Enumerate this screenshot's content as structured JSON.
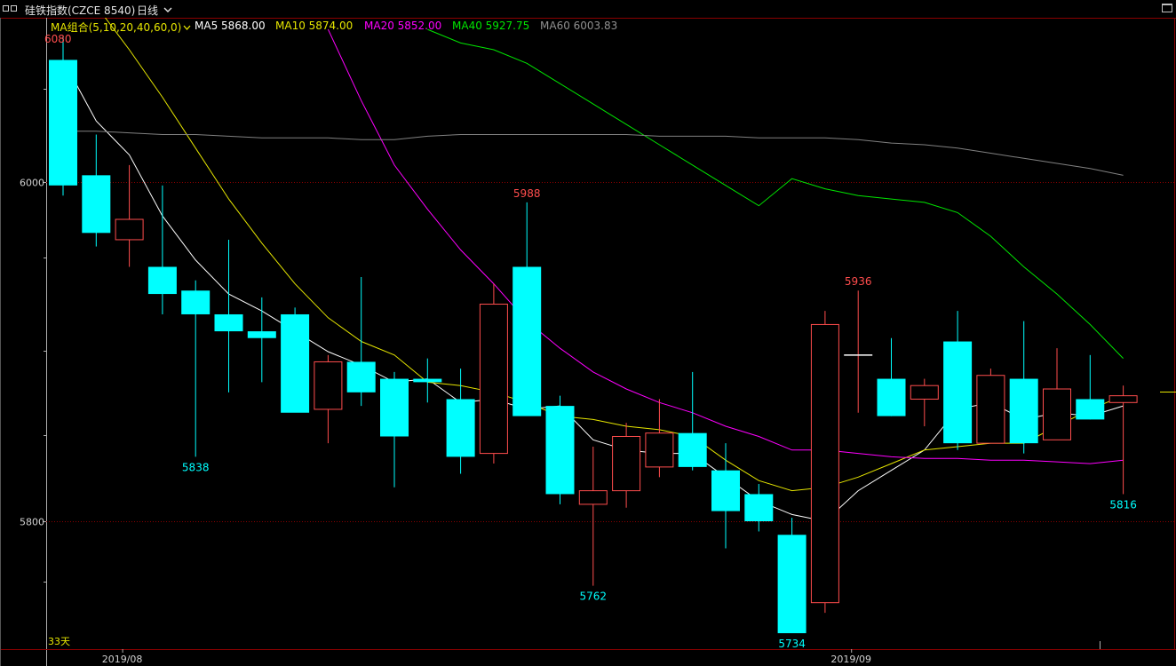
{
  "window": {
    "title": "硅铁指数(CZCE 8540)",
    "period": "日线"
  },
  "ma_bar": {
    "group_label": "MA组合(5,10,20,40,60,0)",
    "ma5": {
      "label": "MA5 5868.00",
      "color": "#ffffff"
    },
    "ma10": {
      "label": "MA10 5874.00",
      "color": "#e6e600"
    },
    "ma20": {
      "label": "MA20 5852.00",
      "color": "#ff00ff"
    },
    "ma40": {
      "label": "MA40 5927.75",
      "color": "#00e600"
    },
    "ma60": {
      "label": "MA60 6003.83",
      "color": "#808080"
    }
  },
  "colors": {
    "up": "#ff4d4d",
    "down": "#00ffff",
    "grid": "#8a0000",
    "axis_text": "#d0d0d0",
    "label_up": "#ff4d4d",
    "label_down": "#00ffff"
  },
  "icons": [
    "menu-icon",
    "chevron-down-icon",
    "maximize-icon"
  ],
  "footer": {
    "day_count": "33天"
  },
  "chart_data": {
    "type": "candlestick",
    "y_ticks": [
      6000,
      5800
    ],
    "y_range": [
      5668,
      6084
    ],
    "x_labels": [
      {
        "text": "2019/08",
        "index": 2
      },
      {
        "text": "2019/09",
        "index": 24
      }
    ],
    "top_label": "6080",
    "annotations": [
      {
        "text": "5988",
        "index": 14,
        "value": 5988,
        "kind": "high"
      },
      {
        "text": "5936",
        "index": 24,
        "value": 5936,
        "kind": "high"
      },
      {
        "text": "5838",
        "index": 4,
        "value": 5838,
        "kind": "low"
      },
      {
        "text": "5762",
        "index": 16,
        "value": 5762,
        "kind": "low"
      },
      {
        "text": "5734",
        "index": 22,
        "value": 5734,
        "kind": "low"
      },
      {
        "text": "5816",
        "index": 32,
        "value": 5816,
        "kind": "low"
      }
    ],
    "candles": [
      {
        "o": 6072,
        "h": 6086,
        "l": 5992,
        "c": 5998
      },
      {
        "o": 6004,
        "h": 6028,
        "l": 5962,
        "c": 5970
      },
      {
        "o": 5966,
        "h": 6010,
        "l": 5950,
        "c": 5978
      },
      {
        "o": 5950,
        "h": 5998,
        "l": 5922,
        "c": 5934
      },
      {
        "o": 5936,
        "h": 5942,
        "l": 5838,
        "c": 5922
      },
      {
        "o": 5922,
        "h": 5966,
        "l": 5876,
        "c": 5912
      },
      {
        "o": 5912,
        "h": 5932,
        "l": 5882,
        "c": 5908
      },
      {
        "o": 5922,
        "h": 5926,
        "l": 5866,
        "c": 5864
      },
      {
        "o": 5866,
        "h": 5898,
        "l": 5846,
        "c": 5894
      },
      {
        "o": 5894,
        "h": 5944,
        "l": 5868,
        "c": 5876
      },
      {
        "o": 5884,
        "h": 5888,
        "l": 5820,
        "c": 5850
      },
      {
        "o": 5884,
        "h": 5896,
        "l": 5870,
        "c": 5882
      },
      {
        "o": 5872,
        "h": 5890,
        "l": 5828,
        "c": 5838
      },
      {
        "o": 5840,
        "h": 5940,
        "l": 5834,
        "c": 5928
      },
      {
        "o": 5950,
        "h": 5988,
        "l": 5866,
        "c": 5862
      },
      {
        "o": 5868,
        "h": 5874,
        "l": 5810,
        "c": 5816
      },
      {
        "o": 5810,
        "h": 5844,
        "l": 5762,
        "c": 5818
      },
      {
        "o": 5818,
        "h": 5858,
        "l": 5808,
        "c": 5850
      },
      {
        "o": 5832,
        "h": 5872,
        "l": 5826,
        "c": 5852
      },
      {
        "o": 5852,
        "h": 5888,
        "l": 5830,
        "c": 5832
      },
      {
        "o": 5830,
        "h": 5846,
        "l": 5784,
        "c": 5806
      },
      {
        "o": 5816,
        "h": 5822,
        "l": 5794,
        "c": 5800
      },
      {
        "o": 5792,
        "h": 5802,
        "l": 5734,
        "c": 5734
      },
      {
        "o": 5752,
        "h": 5924,
        "l": 5746,
        "c": 5916
      },
      {
        "o": 5898,
        "h": 5936,
        "l": 5864,
        "c": 5898
      },
      {
        "o": 5884,
        "h": 5908,
        "l": 5862,
        "c": 5862
      },
      {
        "o": 5872,
        "h": 5884,
        "l": 5856,
        "c": 5880
      },
      {
        "o": 5906,
        "h": 5924,
        "l": 5842,
        "c": 5846
      },
      {
        "o": 5846,
        "h": 5890,
        "l": 5846,
        "c": 5886
      },
      {
        "o": 5884,
        "h": 5918,
        "l": 5840,
        "c": 5846
      },
      {
        "o": 5848,
        "h": 5902,
        "l": 5848,
        "c": 5878
      },
      {
        "o": 5872,
        "h": 5898,
        "l": 5860,
        "c": 5860
      },
      {
        "o": 5870,
        "h": 5880,
        "l": 5816,
        "c": 5874
      }
    ],
    "series": [
      {
        "name": "MA5",
        "color": "#ffffff",
        "values": [
          6072,
          6036,
          6016,
          5980,
          5954,
          5934,
          5924,
          5912,
          5900,
          5892,
          5882,
          5884,
          5870,
          5872,
          5866,
          5868,
          5848,
          5842,
          5840,
          5840,
          5826,
          5812,
          5804,
          5800,
          5818,
          5830,
          5842,
          5866,
          5870,
          5860,
          5864,
          5862,
          5868
        ]
      },
      {
        "name": "MA10",
        "color": "#e6e600",
        "values": [
          6130,
          6104,
          6078,
          6050,
          6020,
          5990,
          5964,
          5940,
          5920,
          5906,
          5898,
          5882,
          5880,
          5876,
          5870,
          5862,
          5860,
          5856,
          5854,
          5850,
          5836,
          5824,
          5818,
          5820,
          5826,
          5834,
          5842,
          5844,
          5846,
          5846,
          5856,
          5866,
          5874
        ]
      },
      {
        "name": "MA20",
        "color": "#ff00ff",
        "values": [
          null,
          null,
          null,
          null,
          null,
          null,
          null,
          null,
          6090,
          6048,
          6010,
          5984,
          5960,
          5940,
          5918,
          5902,
          5888,
          5878,
          5870,
          5864,
          5856,
          5850,
          5842,
          5842,
          5840,
          5838,
          5837,
          5837,
          5836,
          5836,
          5835,
          5834,
          5836
        ]
      },
      {
        "name": "MA40",
        "color": "#00e600",
        "values": [
          null,
          null,
          null,
          null,
          null,
          null,
          null,
          null,
          null,
          null,
          null,
          6090,
          6082,
          6078,
          6070,
          6058,
          6046,
          6034,
          6022,
          6010,
          5998,
          5986,
          6002,
          5996,
          5992,
          5990,
          5988,
          5982,
          5968,
          5950,
          5934,
          5916,
          5896
        ]
      },
      {
        "name": "MA60",
        "color": "#808080",
        "values": [
          6030,
          6030,
          6029,
          6028,
          6028,
          6027,
          6026,
          6026,
          6026,
          6025,
          6025,
          6027,
          6028,
          6028,
          6028,
          6028,
          6028,
          6028,
          6027,
          6027,
          6027,
          6026,
          6026,
          6026,
          6025,
          6023,
          6022,
          6020,
          6017,
          6014,
          6011,
          6008,
          6004
        ]
      }
    ]
  }
}
